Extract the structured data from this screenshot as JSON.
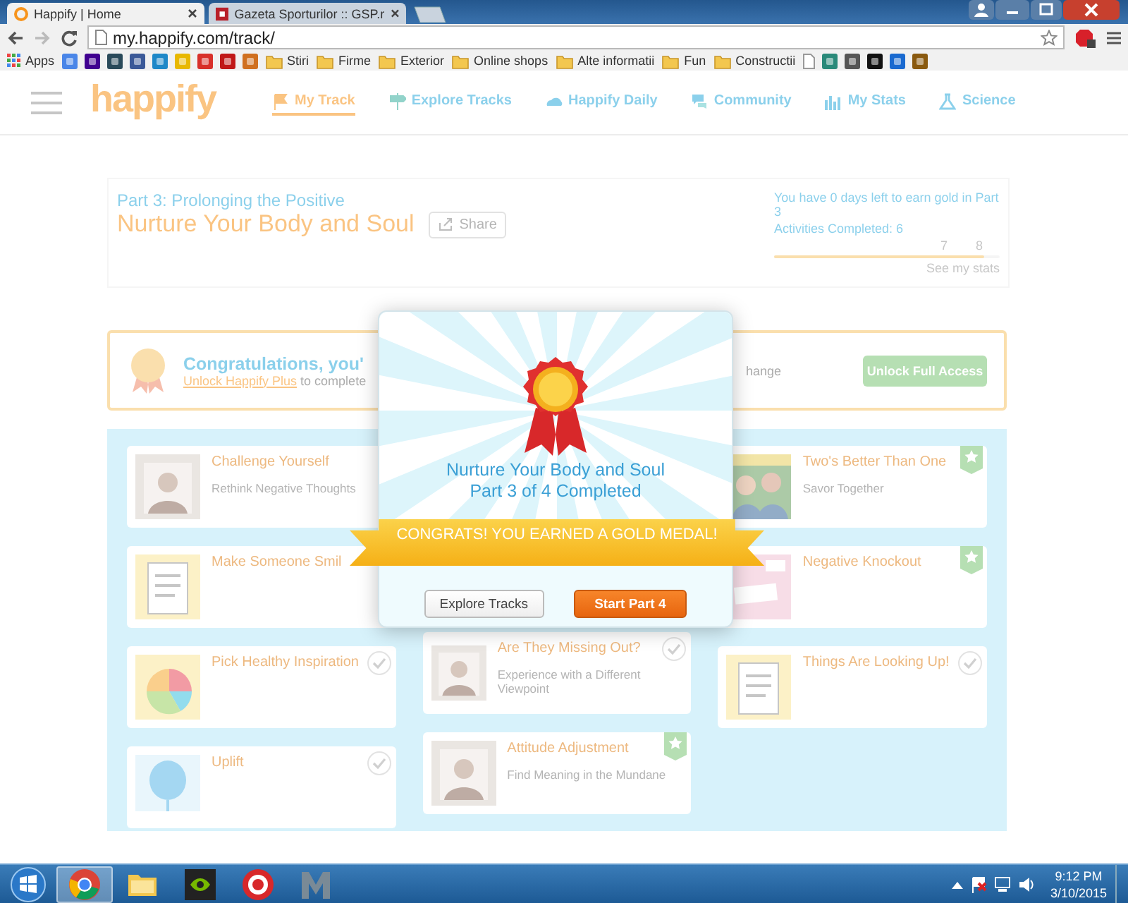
{
  "browser": {
    "tabs": [
      {
        "title": "Happify | Home",
        "selected": true
      },
      {
        "title": "Gazeta Sporturilor :: GSP.r",
        "selected": false
      }
    ],
    "url": "my.happify.com/track/",
    "bookmarks": [
      {
        "kind": "apps",
        "label": "Apps"
      },
      {
        "kind": "icon",
        "color": "#4a86e8"
      },
      {
        "kind": "icon",
        "color": "#400090"
      },
      {
        "kind": "icon",
        "color": "#2a4a5a"
      },
      {
        "kind": "icon",
        "color": "#3b5998"
      },
      {
        "kind": "icon",
        "color": "#1e88c8"
      },
      {
        "kind": "icon",
        "color": "#e8b800"
      },
      {
        "kind": "icon",
        "color": "#d8302a"
      },
      {
        "kind": "icon",
        "color": "#c01818"
      },
      {
        "kind": "icon",
        "color": "#d07020"
      },
      {
        "kind": "folder",
        "label": "Stiri"
      },
      {
        "kind": "folder",
        "label": "Firme"
      },
      {
        "kind": "folder",
        "label": "Exterior"
      },
      {
        "kind": "folder",
        "label": "Online shops"
      },
      {
        "kind": "folder",
        "label": "Alte informatii"
      },
      {
        "kind": "folder",
        "label": "Fun"
      },
      {
        "kind": "folder",
        "label": "Constructii"
      },
      {
        "kind": "page"
      },
      {
        "kind": "icon",
        "color": "#2a8a7a"
      },
      {
        "kind": "icon",
        "color": "#555555"
      },
      {
        "kind": "icon",
        "color": "#111111"
      },
      {
        "kind": "icon",
        "color": "#1a6ad0"
      },
      {
        "kind": "icon",
        "color": "#8a5a10"
      }
    ]
  },
  "page": {
    "logo": "happify",
    "nav": [
      {
        "label": "My Track",
        "selected": true
      },
      {
        "label": "Explore Tracks",
        "selected": false
      },
      {
        "label": "Happify Daily",
        "selected": false
      },
      {
        "label": "Community",
        "selected": false
      },
      {
        "label": "My Stats",
        "selected": false
      },
      {
        "label": "Science",
        "selected": false
      }
    ],
    "hero": {
      "part": "Part 3: Prolonging the Positive",
      "title": "Nurture Your Body and Soul",
      "share": "Share",
      "deadline": "You have 0 days left to earn gold in Part 3",
      "activities": "Activities Completed: 6",
      "level": 0.93,
      "ticks": [
        "7",
        "8"
      ],
      "stats_link": "See my stats"
    },
    "banner": {
      "title": "Congratulations, you'",
      "link": "Unlock Happify Plus",
      "text": " to complete",
      "text_end": "hange",
      "button": "Unlock Full Access"
    },
    "card_columns": [
      [
        {
          "title": "Challenge Yourself",
          "subtitle": "Rethink Negative Thoughts",
          "kind": "plain"
        },
        {
          "title": "Make Someone Smil",
          "kind": "plain"
        },
        {
          "title": "Pick Healthy Inspiration",
          "kind": "check"
        },
        {
          "title": "Uplift",
          "kind": "check"
        }
      ],
      [
        {
          "title": "Are They Missing Out?",
          "subtitle": "Experience with a Different Viewpoint",
          "kind": "check"
        },
        {
          "title": "Attitude Adjustment",
          "subtitle": "Find Meaning in the Mundane",
          "kind": "star"
        }
      ],
      [
        {
          "title": "Two's Better Than One",
          "subtitle": "Savor Together",
          "kind": "star"
        },
        {
          "title": "Negative Knockout",
          "kind": "star"
        },
        {
          "title": "Things Are Looking Up!",
          "kind": "check"
        }
      ]
    ]
  },
  "modal": {
    "track": "Nurture Your Body and Soul",
    "progress": "Part 3 of 4 Completed",
    "ribbon": "CONGRATS! YOU EARNED A GOLD MEDAL!",
    "buttons": [
      {
        "label": "Explore Tracks",
        "kind": "secondary"
      },
      {
        "label": "Start Part 4",
        "kind": "primary"
      }
    ]
  },
  "taskbar": {
    "apps": [
      {
        "kind": "chrome",
        "selected": true
      },
      {
        "kind": "explorer",
        "selected": false
      },
      {
        "kind": "nvidia",
        "selected": false
      },
      {
        "kind": "target",
        "selected": false
      },
      {
        "kind": "m",
        "selected": false
      }
    ],
    "time": "9:12 PM",
    "date": "3/10/2015"
  }
}
